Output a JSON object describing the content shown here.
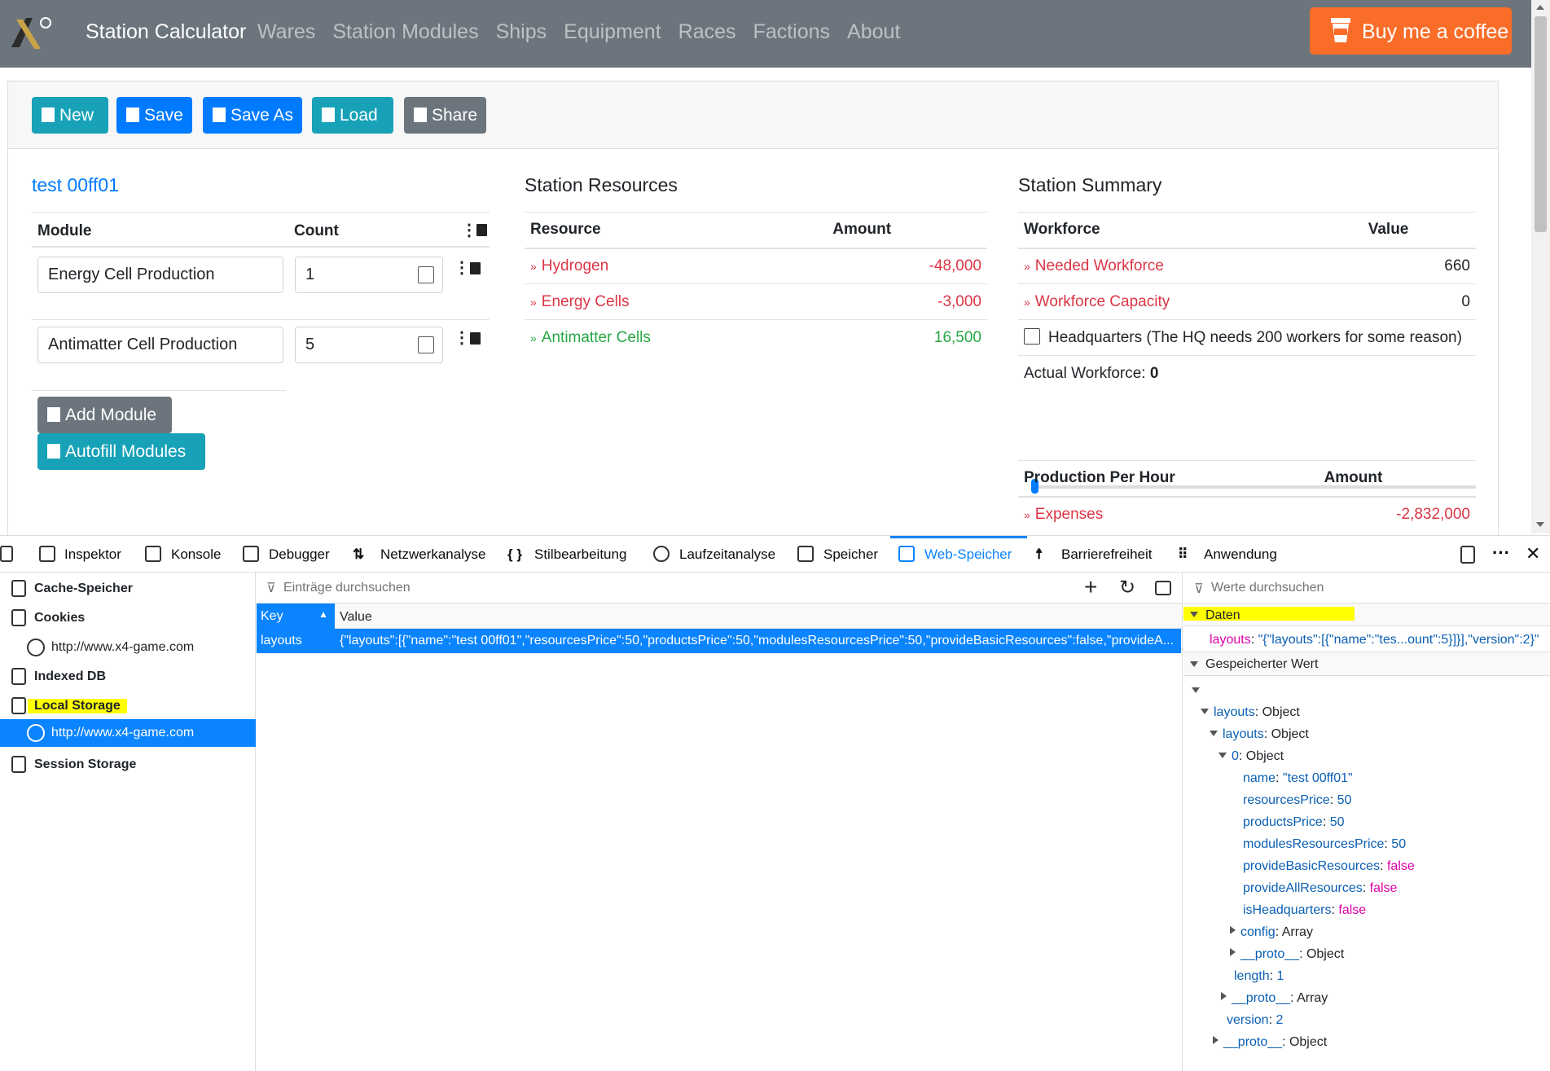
{
  "navbar": {
    "brand": "Station Calculator",
    "links": [
      "Wares",
      "Station Modules",
      "Ships",
      "Equipment",
      "Races",
      "Factions",
      "About"
    ],
    "coffee": "Buy me a coffee"
  },
  "toolbar": {
    "new": "New",
    "save": "Save",
    "save_as": "Save As",
    "load": "Load",
    "share": "Share"
  },
  "layout_name": "test 00ff01",
  "modules": {
    "col_module": "Module",
    "col_count": "Count",
    "rows": [
      {
        "name": "Energy Cell Production",
        "count": "1"
      },
      {
        "name": "Antimatter Cell Production",
        "count": "5"
      }
    ],
    "add": "Add Module",
    "autofill": "Autofill Modules"
  },
  "resources": {
    "title": "Station Resources",
    "col_resource": "Resource",
    "col_amount": "Amount",
    "rows": [
      {
        "name": "Hydrogen",
        "amount": "-48,000"
      },
      {
        "name": "Energy Cells",
        "amount": "-3,000"
      },
      {
        "name": "Antimatter Cells",
        "amount": "16,500"
      }
    ]
  },
  "summary": {
    "title": "Station Summary",
    "col_workforce": "Workforce",
    "col_value": "Value",
    "needed": "Needed Workforce",
    "needed_val": "660",
    "capacity": "Workforce Capacity",
    "capacity_val": "0",
    "hq": "Headquarters (The HQ needs 200 workers for some reason)",
    "actual_label": "Actual Workforce:",
    "actual_val": "0",
    "slider_fraction": 0,
    "col_production": "Production Per Hour",
    "col_amount": "Amount",
    "expenses": "Expenses",
    "expenses_val": "-2,832,000"
  },
  "devtools": {
    "tabs": [
      "Inspektor",
      "Konsole",
      "Debugger",
      "Netzwerkanalyse",
      "Stilbearbeitung",
      "Laufzeitanalyse",
      "Speicher",
      "Web-Speicher",
      "Barrierefreiheit",
      "Anwendung"
    ],
    "sidebar": [
      "Cache-Speicher",
      "Cookies",
      "http://www.x4-game.com",
      "Indexed DB",
      "Local Storage",
      "http://www.x4-game.com",
      "Session Storage"
    ],
    "filter_entries": "Einträge durchsuchen",
    "col_key": "Key",
    "col_value": "Value",
    "row_key": "layouts",
    "row_value": "{\"layouts\":[{\"name\":\"test 00ff01\",\"resourcesPrice\":50,\"productsPrice\":50,\"modulesResourcesPrice\":50,\"provideBasicResources\":false,\"provideA...",
    "filter_values": "Werte durchsuchen",
    "data_header": "Daten",
    "data_key": "layouts",
    "data_value": "\"{\"layouts\":[{\"name\":\"tes...ount\":5}]}],\"version\":2}\"",
    "stored_header": "Gespeicherter Wert",
    "tree": {
      "layouts1": "layouts",
      "layouts2": "layouts",
      "obj": "Object",
      "idx": "0",
      "name_k": "name",
      "name_v": "\"test 00ff01\"",
      "rp_k": "resourcesPrice",
      "rp_v": "50",
      "pp_k": "productsPrice",
      "pp_v": "50",
      "mrp_k": "modulesResourcesPrice",
      "mrp_v": "50",
      "pbr_k": "provideBasicResources",
      "pbr_v": "false",
      "par_k": "provideAllResources",
      "par_v": "false",
      "hq_k": "isHeadquarters",
      "hq_v": "false",
      "config_k": "config",
      "array": "Array",
      "proto": "__proto__",
      "length_k": "length",
      "length_v": "1",
      "version_k": "version",
      "version_v": "2"
    }
  }
}
